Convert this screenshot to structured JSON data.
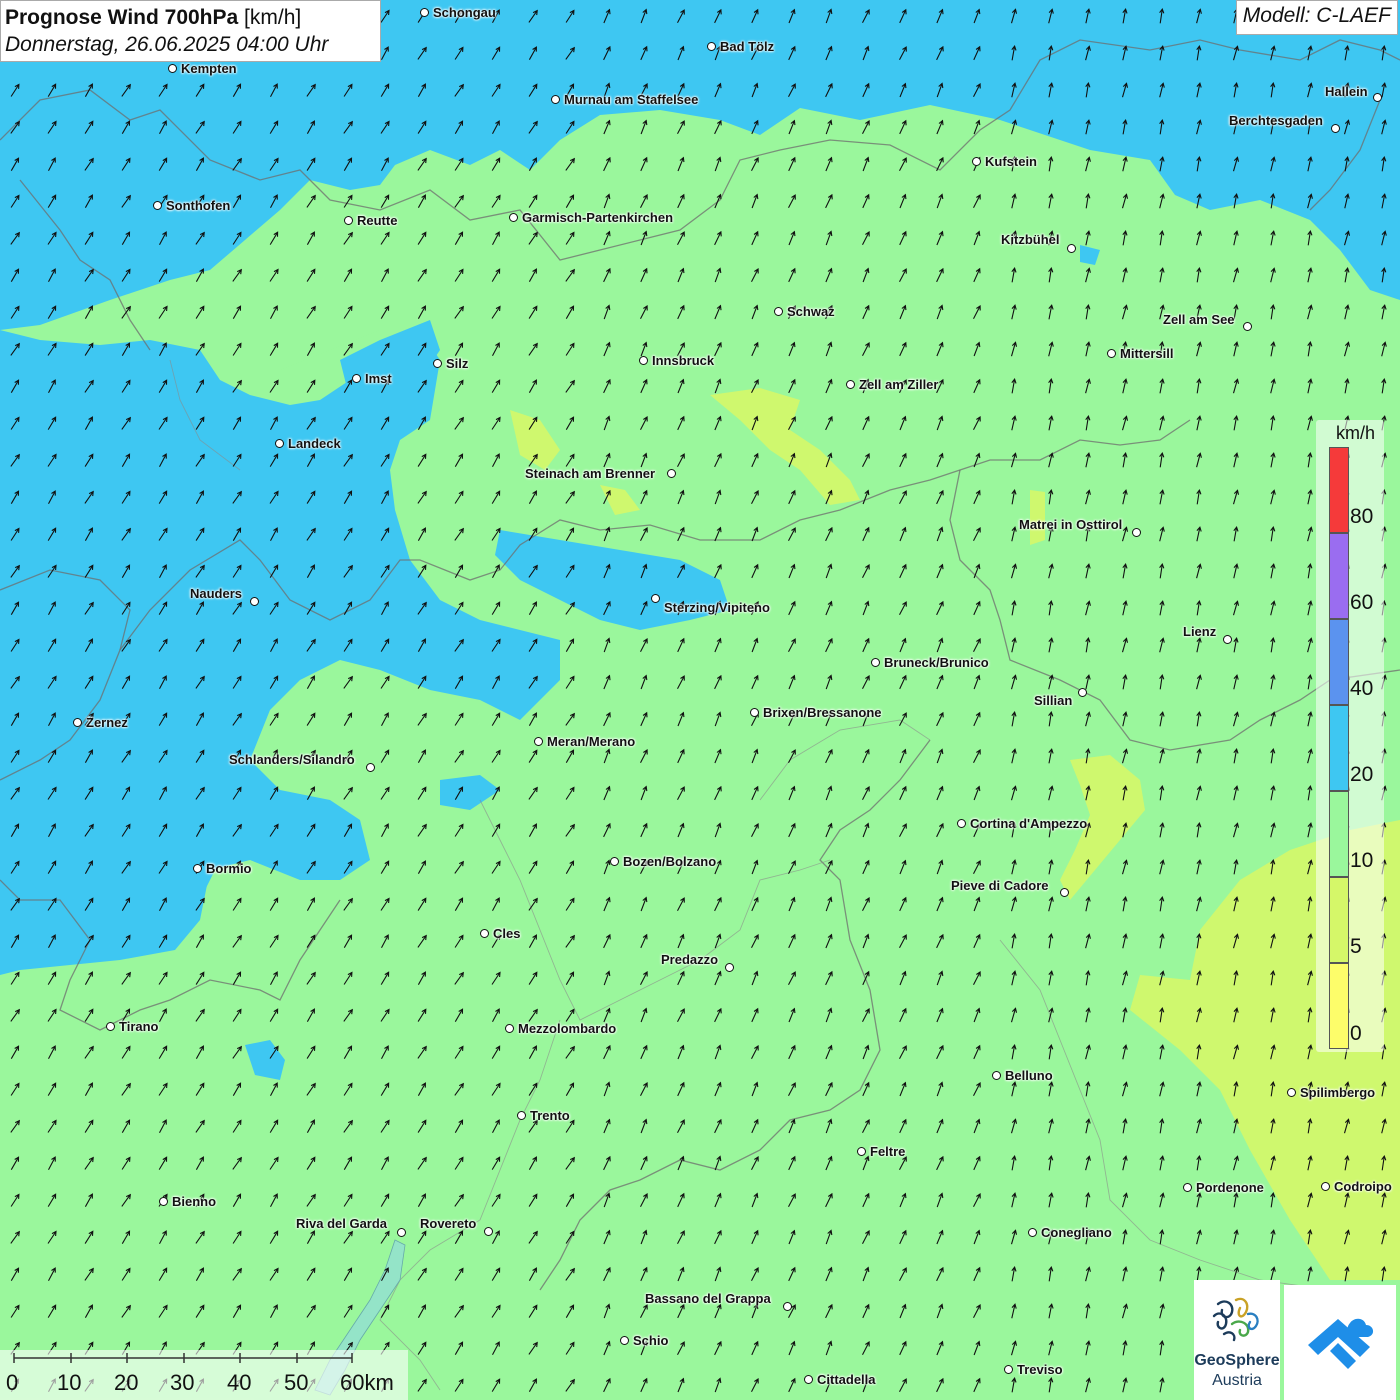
{
  "title": {
    "main": "Prognose Wind 700hPa",
    "unit": "[km/h]",
    "datetime": "Donnerstag, 26.06.2025 04:00 Uhr"
  },
  "model": "Modell: C-LAEF",
  "legend": {
    "unit": "km/h",
    "labels": [
      "80",
      "60",
      "40",
      "20",
      "10",
      "5",
      "0"
    ],
    "colors": {
      "0-5": "#fdfd6a",
      "5-10": "#d5f769",
      "10-20": "#9af79c",
      "20-40": "#3ec7f2",
      "40-60": "#5b93ef",
      "60-80": "#9a6df0",
      "80+": "#f53a3a"
    }
  },
  "scale_bar": {
    "labels": [
      "0",
      "10",
      "20",
      "30",
      "40",
      "50",
      "60km"
    ]
  },
  "logo": {
    "name_line1": "GeoSphere",
    "name_line2": "Austria"
  },
  "cities": [
    {
      "name": "Schongau"
    },
    {
      "name": "Bad Tölz"
    },
    {
      "name": "Kempten"
    },
    {
      "name": "Murnau am Staffelsee"
    },
    {
      "name": "Hallein"
    },
    {
      "name": "Berchtesgaden"
    },
    {
      "name": "Kufstein"
    },
    {
      "name": "Sonthofen"
    },
    {
      "name": "Reutte"
    },
    {
      "name": "Garmisch-Partenkirchen"
    },
    {
      "name": "Kitzbühel"
    },
    {
      "name": "Schwaz"
    },
    {
      "name": "Zell am See"
    },
    {
      "name": "Mittersill"
    },
    {
      "name": "Innsbruck"
    },
    {
      "name": "Silz"
    },
    {
      "name": "Imst"
    },
    {
      "name": "Zell am Ziller"
    },
    {
      "name": "Landeck"
    },
    {
      "name": "Steinach am Brenner"
    },
    {
      "name": "Matrei in Osttirol"
    },
    {
      "name": "Nauders"
    },
    {
      "name": "Sterzing/Vipiteno"
    },
    {
      "name": "Lienz"
    },
    {
      "name": "Bruneck/Brunico"
    },
    {
      "name": "Sillian"
    },
    {
      "name": "Brixen/Bressanone"
    },
    {
      "name": "Zernez"
    },
    {
      "name": "Meran/Merano"
    },
    {
      "name": "Schlanders/Silandro"
    },
    {
      "name": "Cortina d'Ampezzo"
    },
    {
      "name": "Bozen/Bolzano"
    },
    {
      "name": "Bormio"
    },
    {
      "name": "Pieve di Cadore"
    },
    {
      "name": "Cles"
    },
    {
      "name": "Predazzo"
    },
    {
      "name": "Tirano"
    },
    {
      "name": "Mezzolombardo"
    },
    {
      "name": "Belluno"
    },
    {
      "name": "Spilimbergo"
    },
    {
      "name": "Trento"
    },
    {
      "name": "Feltre"
    },
    {
      "name": "Pordenone"
    },
    {
      "name": "Codroipo"
    },
    {
      "name": "Bienno"
    },
    {
      "name": "Riva del Garda"
    },
    {
      "name": "Rovereto"
    },
    {
      "name": "Conegliano"
    },
    {
      "name": "Bassano del Grappa"
    },
    {
      "name": "Schio"
    },
    {
      "name": "Treviso"
    },
    {
      "name": "Cittadella"
    }
  ]
}
